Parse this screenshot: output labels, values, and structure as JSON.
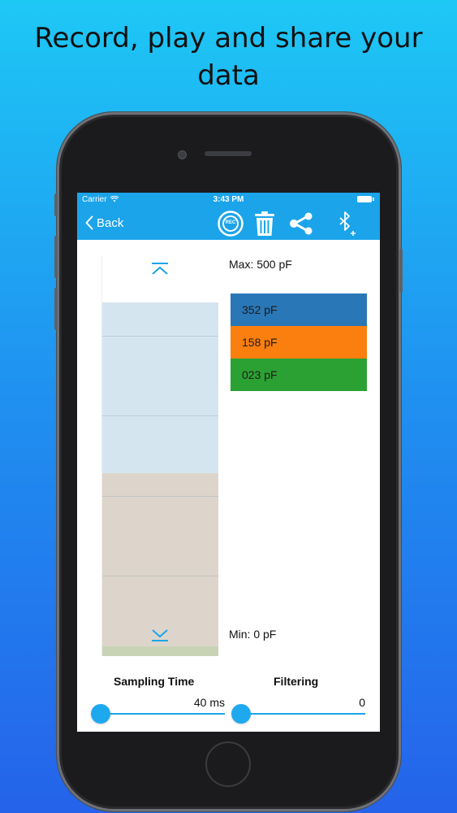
{
  "headline": {
    "line1": "Record, play and share your",
    "line2": "data"
  },
  "status_bar": {
    "carrier": "Carrier",
    "time": "3:43 PM"
  },
  "navbar": {
    "back_label": "Back",
    "record_badge": "REC"
  },
  "gauge": {
    "max_label": "Max: 500 pF",
    "min_label": "Min: 0 pF"
  },
  "legend": [
    {
      "label": "352 pF",
      "color": "#2a77b7"
    },
    {
      "label": "158 pF",
      "color": "#fb7f0e"
    },
    {
      "label": "023 pF",
      "color": "#2ca133"
    }
  ],
  "sliders": [
    {
      "label": "Sampling Time",
      "value": "40 ms",
      "position": 0.0
    },
    {
      "label": "Filtering",
      "value": "0",
      "position": 0.0
    }
  ],
  "colors": {
    "accent": "#1ba4ea"
  }
}
